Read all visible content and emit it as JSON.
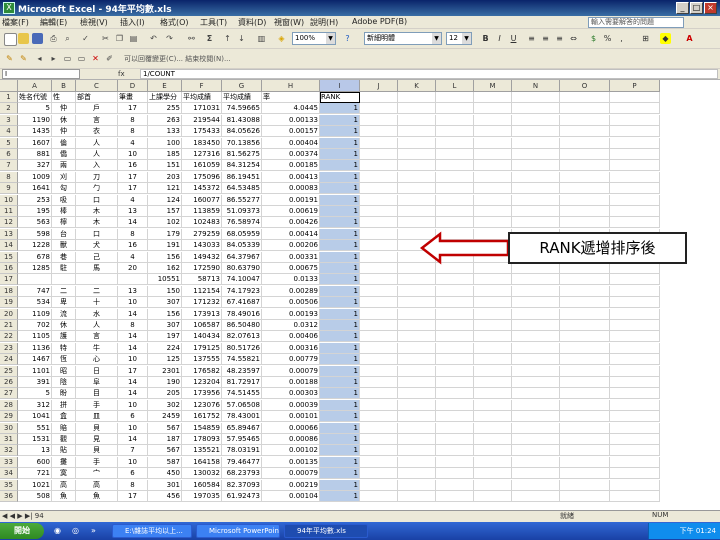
{
  "window": {
    "title": "Microsoft Excel - 94年平均數.xls"
  },
  "menu": [
    "檔案(F)",
    "編輯(E)",
    "檢視(V)",
    "插入(I)",
    "格式(O)",
    "工具(T)",
    "資料(D)",
    "視窗(W)",
    "說明(H)",
    "Adobe PDF(B)"
  ],
  "help_box": "輸入需要解答的問題",
  "toolbar": {
    "zoom": "100%",
    "font": "新細明體",
    "font_size": "12",
    "tb2_text": "可以回覆變更(C)... 結束校閱(N)..."
  },
  "formula_bar": {
    "name_box": "I",
    "fx": "fx",
    "formula": "1/COUNT"
  },
  "columns": [
    "A",
    "B",
    "C",
    "D",
    "E",
    "F",
    "G",
    "H",
    "I",
    "J",
    "K",
    "L",
    "M",
    "N",
    "O",
    "P"
  ],
  "header_row": [
    "姓名代號",
    "性",
    "部首",
    "筆畫",
    "上課學分",
    "平均成績",
    "平均成績",
    "率",
    "RANK",
    "",
    "",
    "",
    "",
    "",
    "",
    ""
  ],
  "rows": [
    [
      "2",
      "5",
      "仲",
      "戶",
      "17",
      "255",
      "171031",
      "74.59665",
      "4.0445",
      "1"
    ],
    [
      "3",
      "1190",
      "休",
      "言",
      "8",
      "263",
      "219544",
      "81.43088",
      "0.00133",
      "1"
    ],
    [
      "4",
      "1435",
      "仲",
      "衣",
      "8",
      "133",
      "175433",
      "84.05626",
      "0.00157",
      "1"
    ],
    [
      "5",
      "1607",
      "倫",
      "人",
      "4",
      "100",
      "183450",
      "70.13856",
      "0.00404",
      "1"
    ],
    [
      "6",
      "881",
      "僑",
      "人",
      "10",
      "185",
      "127316",
      "81.56275",
      "0.00374",
      "1"
    ],
    [
      "7",
      "327",
      "兩",
      "入",
      "16",
      "151",
      "161059",
      "84.31254",
      "0.00185",
      "1"
    ],
    [
      "8",
      "1009",
      "刈",
      "刀",
      "17",
      "203",
      "175096",
      "86.19451",
      "0.00413",
      "1"
    ],
    [
      "9",
      "1641",
      "勾",
      "勹",
      "17",
      "121",
      "145372",
      "64.53485",
      "0.00083",
      "1"
    ],
    [
      "10",
      "253",
      "吸",
      "口",
      "4",
      "124",
      "160077",
      "86.55277",
      "0.00191",
      "1"
    ],
    [
      "11",
      "195",
      "棒",
      "木",
      "13",
      "157",
      "113859",
      "51.09373",
      "0.00619",
      "1"
    ],
    [
      "12",
      "563",
      "檸",
      "木",
      "14",
      "102",
      "102483",
      "76.58974",
      "0.00426",
      "1"
    ],
    [
      "13",
      "598",
      "台",
      "口",
      "8",
      "179",
      "279259",
      "68.05959",
      "0.00414",
      "1"
    ],
    [
      "14",
      "1228",
      "獸",
      "犬",
      "16",
      "191",
      "143033",
      "84.05339",
      "0.00206",
      "1"
    ],
    [
      "15",
      "678",
      "巷",
      "己",
      "4",
      "156",
      "149432",
      "64.37967",
      "0.00331",
      "1"
    ],
    [
      "16",
      "1285",
      "駐",
      "馬",
      "20",
      "162",
      "172590",
      "80.63790",
      "0.00675",
      "1"
    ],
    [
      "17",
      "",
      "",
      "",
      "",
      "10551",
      "58713",
      "74.10047",
      "0.0133",
      "1"
    ],
    [
      "18",
      "747",
      "二",
      "二",
      "13",
      "150",
      "112154",
      "74.17923",
      "0.00289",
      "1"
    ],
    [
      "19",
      "534",
      "卑",
      "十",
      "10",
      "307",
      "171232",
      "67.41687",
      "0.00506",
      "1"
    ],
    [
      "20",
      "1109",
      "流",
      "水",
      "14",
      "156",
      "173913",
      "78.49016",
      "0.00193",
      "1"
    ],
    [
      "21",
      "702",
      "休",
      "人",
      "8",
      "307",
      "106587",
      "86.50480",
      "0.0312",
      "1"
    ],
    [
      "22",
      "1105",
      "護",
      "言",
      "14",
      "197",
      "140434",
      "82.07613",
      "0.00406",
      "1"
    ],
    [
      "23",
      "1136",
      "特",
      "牛",
      "14",
      "224",
      "179125",
      "80.51726",
      "0.00316",
      "1"
    ],
    [
      "24",
      "1467",
      "恆",
      "心",
      "10",
      "125",
      "137555",
      "74.55821",
      "0.00779",
      "1"
    ],
    [
      "25",
      "1101",
      "昭",
      "日",
      "17",
      "2301",
      "176582",
      "48.23597",
      "0.00079",
      "1"
    ],
    [
      "26",
      "391",
      "陰",
      "阜",
      "14",
      "190",
      "123204",
      "81.72917",
      "0.00188",
      "1"
    ],
    [
      "27",
      "5",
      "盼",
      "目",
      "14",
      "205",
      "173956",
      "74.51455",
      "0.00303",
      "1"
    ],
    [
      "28",
      "312",
      "拼",
      "手",
      "10",
      "302",
      "123076",
      "57.06508",
      "0.00039",
      "1"
    ],
    [
      "29",
      "1041",
      "盒",
      "皿",
      "6",
      "2459",
      "161752",
      "78.43001",
      "0.00101",
      "1"
    ],
    [
      "30",
      "551",
      "賠",
      "貝",
      "10",
      "567",
      "154859",
      "65.89467",
      "0.00066",
      "1"
    ],
    [
      "31",
      "1531",
      "觀",
      "見",
      "14",
      "187",
      "178093",
      "57.95465",
      "0.00086",
      "1"
    ],
    [
      "32",
      "13",
      "貼",
      "貝",
      "7",
      "567",
      "135521",
      "78.03191",
      "0.00102",
      "1"
    ],
    [
      "33",
      "600",
      "攤",
      "手",
      "10",
      "587",
      "164158",
      "79.46477",
      "0.00135",
      "1"
    ],
    [
      "34",
      "721",
      "寞",
      "宀",
      "6",
      "450",
      "130032",
      "68.23793",
      "0.00079",
      "1"
    ],
    [
      "35",
      "1021",
      "高",
      "高",
      "8",
      "301",
      "160584",
      "82.37093",
      "0.00219",
      "1"
    ],
    [
      "36",
      "508",
      "魚",
      "魚",
      "17",
      "456",
      "197035",
      "61.92473",
      "0.00104",
      "1"
    ]
  ],
  "callout": "RANK遞增排序後",
  "sheet_tabs": "◀ ◀ ▶ ▶| 94",
  "status": {
    "mode": "就緒",
    "num": "NUM"
  },
  "taskbar": {
    "start": "開始",
    "buttons": [
      "E:\\雜誌平均以上...",
      "Microsoft PowerPoint...",
      "94年平均數.xls"
    ],
    "clock": "下午 01:24"
  }
}
